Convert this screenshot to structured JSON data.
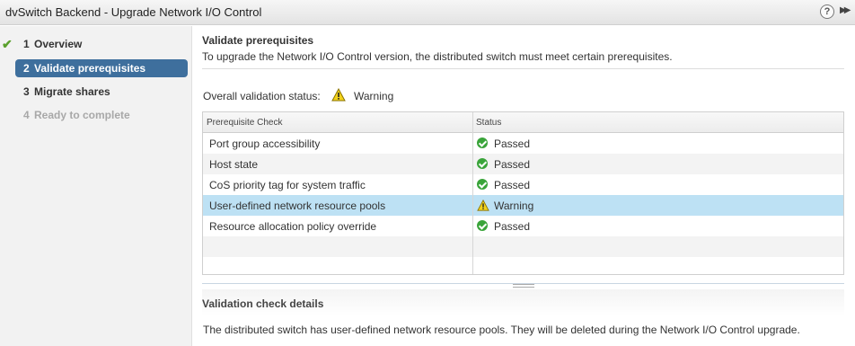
{
  "window": {
    "title": "dvSwitch Backend - Upgrade Network I/O Control",
    "help_glyph": "?",
    "expand_glyph": "▶▶"
  },
  "sidebar": {
    "steps": [
      {
        "num": "1",
        "label": "Overview",
        "state": "completed"
      },
      {
        "num": "2",
        "label": "Validate prerequisites",
        "state": "active"
      },
      {
        "num": "3",
        "label": "Migrate shares",
        "state": "pending"
      },
      {
        "num": "4",
        "label": "Ready to complete",
        "state": "disabled"
      }
    ]
  },
  "main": {
    "title": "Validate prerequisites",
    "description": "To upgrade the Network I/O Control version, the distributed switch must meet certain prerequisites.",
    "overall_label": "Overall validation status:",
    "overall_value": "Warning",
    "table": {
      "columns": [
        "Prerequisite Check",
        "Status"
      ],
      "rows": [
        {
          "check": "Port group accessibility",
          "status": "Passed",
          "icon": "check-circle-icon"
        },
        {
          "check": "Host state",
          "status": "Passed",
          "icon": "check-circle-icon"
        },
        {
          "check": "CoS priority tag for system traffic",
          "status": "Passed",
          "icon": "check-circle-icon"
        },
        {
          "check": "User-defined network resource pools",
          "status": "Warning",
          "icon": "warning-icon",
          "selected": true
        },
        {
          "check": "Resource allocation policy override",
          "status": "Passed",
          "icon": "check-circle-icon"
        }
      ]
    },
    "details_title": "Validation check details",
    "details_text": "The distributed switch has user-defined network resource pools. They will be deleted during the Network I/O Control upgrade."
  },
  "colors": {
    "accent": "#3e6f9d",
    "selected_row": "#bde1f4",
    "ok": "#3aa43a",
    "warning": "#f2d21b",
    "check": "#5aa02c"
  }
}
